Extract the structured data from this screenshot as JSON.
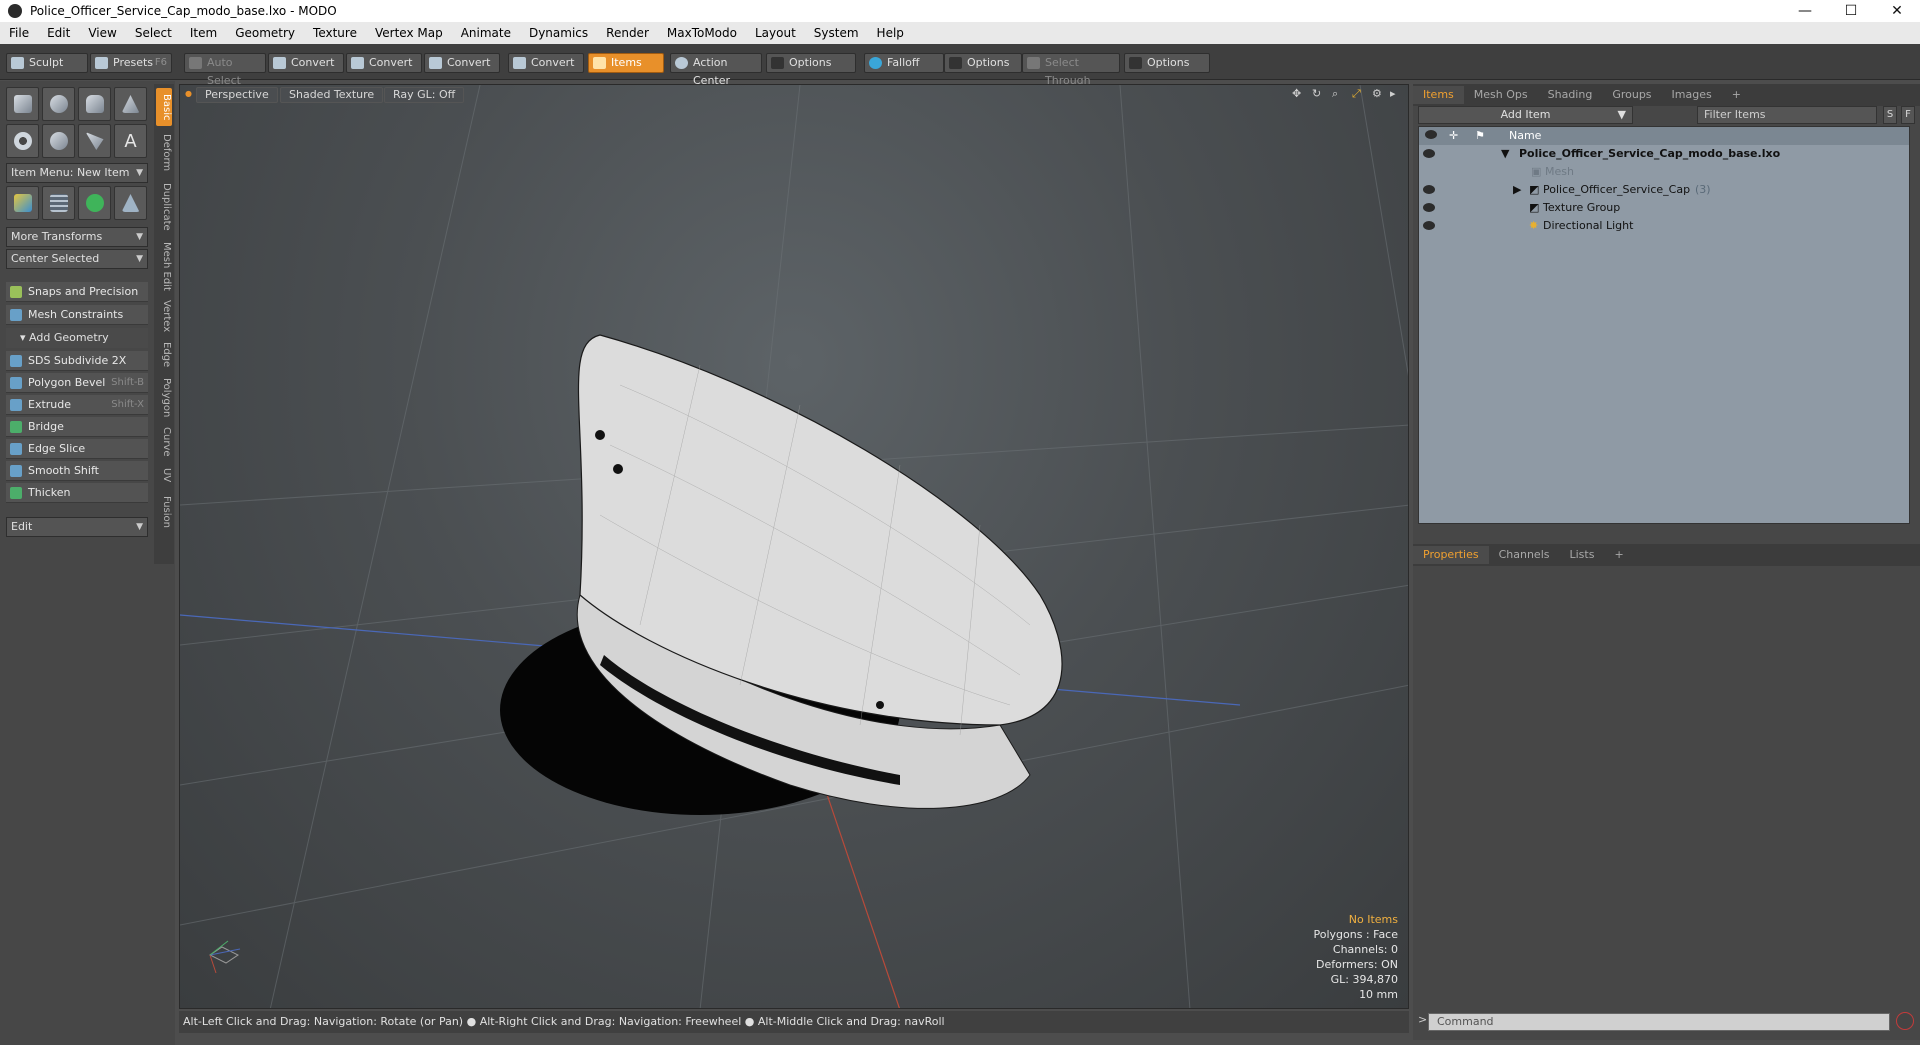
{
  "window": {
    "title": "Police_Officer_Service_Cap_modo_base.lxo - MODO",
    "min": "—",
    "max": "☐",
    "close": "✕"
  },
  "menu": [
    "File",
    "Edit",
    "View",
    "Select",
    "Item",
    "Geometry",
    "Texture",
    "Vertex Map",
    "Animate",
    "Dynamics",
    "Render",
    "MaxToModo",
    "Layout",
    "System",
    "Help"
  ],
  "toolbar": {
    "sculpt": "Sculpt",
    "presets": "Presets",
    "presets_sc": "F6",
    "auto_select": "Auto Select",
    "convert1": "Convert",
    "convert2": "Convert",
    "convert3": "Convert",
    "convert4": "Convert",
    "items": "Items",
    "action_center": "Action Center",
    "options1": "Options",
    "falloff": "Falloff",
    "options2": "Options",
    "select_through": "Select Through",
    "options3": "Options"
  },
  "left": {
    "item_menu": "Item Menu: New Item",
    "more_transforms": "More Transforms",
    "center_selected": "Center Selected",
    "snaps": "Snaps and Precision",
    "mesh_constraints": "Mesh Constraints",
    "add_geometry": "Add Geometry",
    "tools": [
      {
        "label": "SDS Subdivide 2X",
        "sc": ""
      },
      {
        "label": "Polygon Bevel",
        "sc": "Shift-B"
      },
      {
        "label": "Extrude",
        "sc": "Shift-X"
      },
      {
        "label": "Bridge",
        "sc": ""
      },
      {
        "label": "Edge Slice",
        "sc": ""
      },
      {
        "label": "Smooth Shift",
        "sc": ""
      },
      {
        "label": "Thicken",
        "sc": ""
      }
    ],
    "edit": "Edit",
    "vtabs": [
      "Basic",
      "Deform",
      "Duplicate",
      "Mesh Edit",
      "Vertex",
      "Edge",
      "Polygon",
      "Curve",
      "UV",
      "Fusion"
    ]
  },
  "viewport": {
    "perspective": "Perspective",
    "shading": "Shaded Texture",
    "raygl": "Ray GL: Off",
    "hud": {
      "no_items": "No Items",
      "polygons": "Polygons : Face",
      "channels": "Channels: 0",
      "deformers": "Deformers: ON",
      "gl": "GL: 394,870",
      "scale": "10 mm"
    }
  },
  "status": "Alt-Left Click and Drag: Navigation: Rotate (or Pan) ● Alt-Right Click and Drag: Navigation: Freewheel ● Alt-Middle Click and Drag: navRoll",
  "right": {
    "tabs": [
      "Items",
      "Mesh Ops",
      "Shading",
      "Groups",
      "Images",
      "+"
    ],
    "add_item": "Add Item",
    "filter": "Filter Items",
    "s": "S",
    "f": "F",
    "name_col": "Name",
    "tree": {
      "root": "Police_Officer_Service_Cap_modo_base.lxo",
      "mesh": "Mesh",
      "cap": "Police_Officer_Service_Cap",
      "cap_count": "(3)",
      "texture_group": "Texture Group",
      "light": "Directional Light"
    },
    "prop_tabs": [
      "Properties",
      "Channels",
      "Lists",
      "+"
    ]
  },
  "command": {
    "placeholder": "Command",
    "arrow": ">"
  }
}
